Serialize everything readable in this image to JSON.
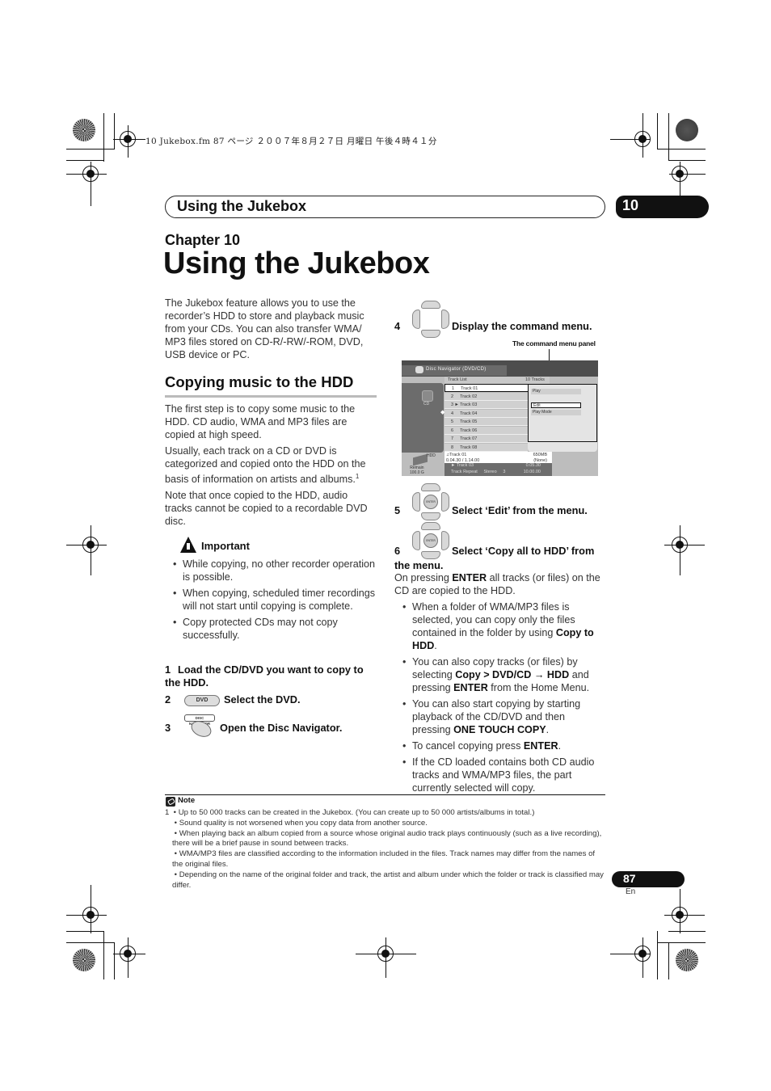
{
  "print_header": "10 Jukebox.fm  87 ページ  ２００７年８月２７日  月曜日  午後４時４１分",
  "running_header": {
    "title": "Using the Jukebox",
    "chapter_number": "10"
  },
  "chapter_label": "Chapter 10",
  "page_title": "Using the Jukebox",
  "intro": "The Jukebox feature allows you to use the recorder’s HDD to store and playback music from your CDs. You can also transfer WMA/ MP3 files stored on CD-R/-RW/-ROM, DVD, USB device or PC.",
  "section": {
    "title": "Copying music to the HDD",
    "paragraphs": [
      "The first step is to copy some music to the HDD. CD audio, WMA and MP3 files are copied at high speed.",
      "Usually, each track on a CD or DVD is categorized and copied onto the HDD on the basis of information on artists and albums.",
      "Note that once copied to the HDD, audio tracks cannot be copied to a recordable DVD disc."
    ],
    "footnote_ref": "1"
  },
  "important": {
    "title": "Important",
    "icon": "warning-hand-icon",
    "items": [
      "While copying, no other recorder operation is possible.",
      "When copying, scheduled timer recordings will not start until copying is complete.",
      "Copy protected CDs may not copy successfully."
    ]
  },
  "steps": [
    {
      "num": "1",
      "text": "Load the CD/DVD you want to copy to the HDD."
    },
    {
      "num": "2",
      "text": "Select the DVD.",
      "button": "DVD"
    },
    {
      "num": "3",
      "text": "Open the Disc Navigator.",
      "button": "DISC NAVIGATOR"
    },
    {
      "num": "4",
      "text": "Display the command menu."
    },
    {
      "num": "5",
      "text": "Select ‘Edit’ from the menu."
    },
    {
      "num": "6",
      "text": "Select ‘Copy all to HDD’ from the menu."
    }
  ],
  "dpad_enter_label": "ENTER",
  "callout": "The command menu panel",
  "screen": {
    "title": "Disc Navigator (DVD/CD)",
    "source_label": "CD",
    "track_list_label": "Track List",
    "track_count": "10 Tracks",
    "tracks": [
      {
        "num": "1",
        "name": "Track 01",
        "marker": ""
      },
      {
        "num": "2",
        "name": "Track 02",
        "marker": ""
      },
      {
        "num": "3",
        "name": "Track 03",
        "marker": "►"
      },
      {
        "num": "4",
        "name": "Track 04",
        "marker": ""
      },
      {
        "num": "5",
        "name": "Track 05",
        "marker": ""
      },
      {
        "num": "6",
        "name": "Track 06",
        "marker": ""
      },
      {
        "num": "7",
        "name": "Track 07",
        "marker": ""
      },
      {
        "num": "8",
        "name": "Track 08",
        "marker": ""
      }
    ],
    "menu": [
      "Play",
      "Edit",
      "Play Mode"
    ],
    "menu_selected": "Edit",
    "info_track": "Track 01",
    "info_time": "0.04.30 / 1.14.00",
    "info_size": "650MB",
    "info_none": "(None)",
    "playing_track": "► Track 03",
    "playing_time": "0.05.30",
    "play_mode": "Track Repeat",
    "audio": "Stereo",
    "audio_num": "3",
    "counter": "10.00.00",
    "hdd_label": "HDD",
    "remain_label": "Remain",
    "remain_value": "100.0 G"
  },
  "after_step6": {
    "lead_pre": "On pressing ",
    "lead_bold": "ENTER",
    "lead_post": " all tracks (or files) on the CD are copied to the HDD.",
    "bullets": [
      {
        "pre": "When a folder of WMA/MP3 files is selected, you can copy only the files contained in the folder by using ",
        "bold": "Copy to HDD",
        "post": "."
      },
      {
        "pre": "You can also copy tracks (or files) by selecting ",
        "bold": "Copy > DVD/CD → HDD",
        "mid": " and pressing ",
        "bold2": "ENTER",
        "post": " from the Home Menu."
      },
      {
        "pre": "You can also start copying by starting playback of the CD/DVD and then pressing ",
        "bold": "ONE TOUCH COPY",
        "post": "."
      },
      {
        "pre": "To cancel copying press ",
        "bold": "ENTER",
        "post": "."
      },
      {
        "pre": "If the CD loaded contains both CD audio tracks and WMA/MP3 files, the part currently selected will copy.",
        "bold": "",
        "post": ""
      }
    ]
  },
  "note": {
    "title": "Note",
    "num": "1",
    "items": [
      "Up to 50 000 tracks can be created in the Jukebox. (You can create up to 50 000 artists/albums in total.)",
      "Sound quality is not worsened when you copy data from another source.",
      "When playing back an album copied from a source whose original audio track plays continuously (such as a live recording), there will be a brief pause in sound between tracks.",
      "WMA/MP3 files are classified according to the information included in the files. Track names may differ from the names of the original files.",
      "Depending on the name of the original folder and track, the artist and album under which the folder or track is classified may differ."
    ]
  },
  "footer": {
    "page_number": "87",
    "language": "En"
  }
}
